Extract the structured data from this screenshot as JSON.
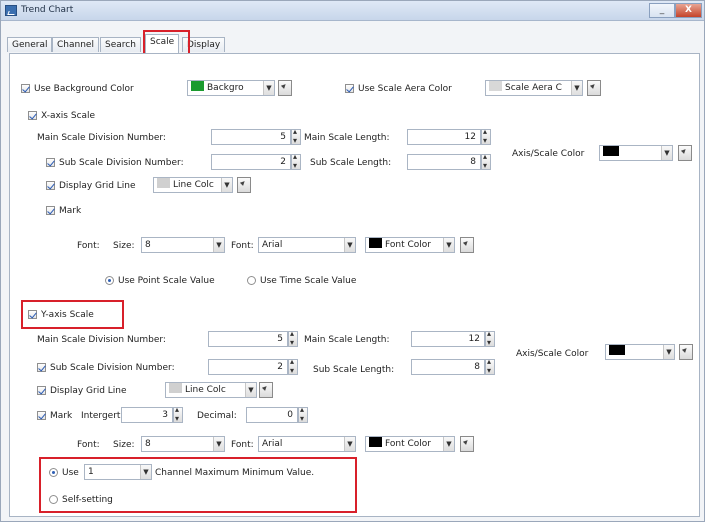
{
  "window": {
    "title": "Trend Chart",
    "minimize": "_",
    "close": "X"
  },
  "tabs": [
    "General",
    "Channel",
    "Search",
    "Scale",
    "Display"
  ],
  "top": {
    "use_background_color": "Use Background Color",
    "background_select": "Backgro",
    "use_scale_area_color": "Use Scale Aera Color",
    "scale_area_select": "Scale Aera C"
  },
  "x_axis": {
    "title": "X-axis Scale",
    "main_div_label": "Main Scale Division Number:",
    "main_div_value": "5",
    "main_len_label": "Main Scale Length:",
    "main_len_value": "12",
    "sub_div_label": "Sub Scale Division Number:",
    "sub_div_value": "2",
    "sub_len_label": "Sub Scale Length:",
    "sub_len_value": "8",
    "axis_color_label": "Axis/Scale Color",
    "grid_label": "Display Grid Line",
    "line_color_select": "Line Colc",
    "mark_label": "Mark",
    "font_label": "Font:",
    "size_label": "Size:",
    "size_value": "8",
    "font_face_label": "Font:",
    "font_face_value": "Arial",
    "font_color_select": "Font Color",
    "point_scale_label": "Use Point Scale Value",
    "time_scale_label": "Use Time Scale Value"
  },
  "y_axis": {
    "title": "Y-axis Scale",
    "main_div_label": "Main Scale Division Number:",
    "main_div_value": "5",
    "main_len_label": "Main Scale Length:",
    "main_len_value": "12",
    "sub_div_label": "Sub Scale Division Number:",
    "sub_div_value": "2",
    "sub_len_label": "Sub Scale Length:",
    "sub_len_value": "8",
    "axis_color_label": "Axis/Scale Color",
    "grid_label": "Display Grid Line",
    "line_color_select": "Line Colc",
    "mark_label": "Mark",
    "integer_label": "Intergert",
    "integer_value": "3",
    "decimal_label": "Decimal:",
    "decimal_value": "0",
    "font_label": "Font:",
    "size_label": "Size:",
    "size_value": "8",
    "font_face_label": "Font:",
    "font_face_value": "Arial",
    "font_color_select": "Font Color",
    "use_label": "Use",
    "channel_select": "1",
    "channel_text": "Channel Maximum Minimum Value.",
    "self_setting_label": "Self-setting"
  },
  "colors": {
    "background_swatch": "#1a9a2e",
    "scale_area_swatch": "#d8d8d8",
    "axis_color": "#000000",
    "line_color_swatch": "#d0d0d0",
    "font_color_swatch": "#000000",
    "annotation": "#d8202a"
  }
}
